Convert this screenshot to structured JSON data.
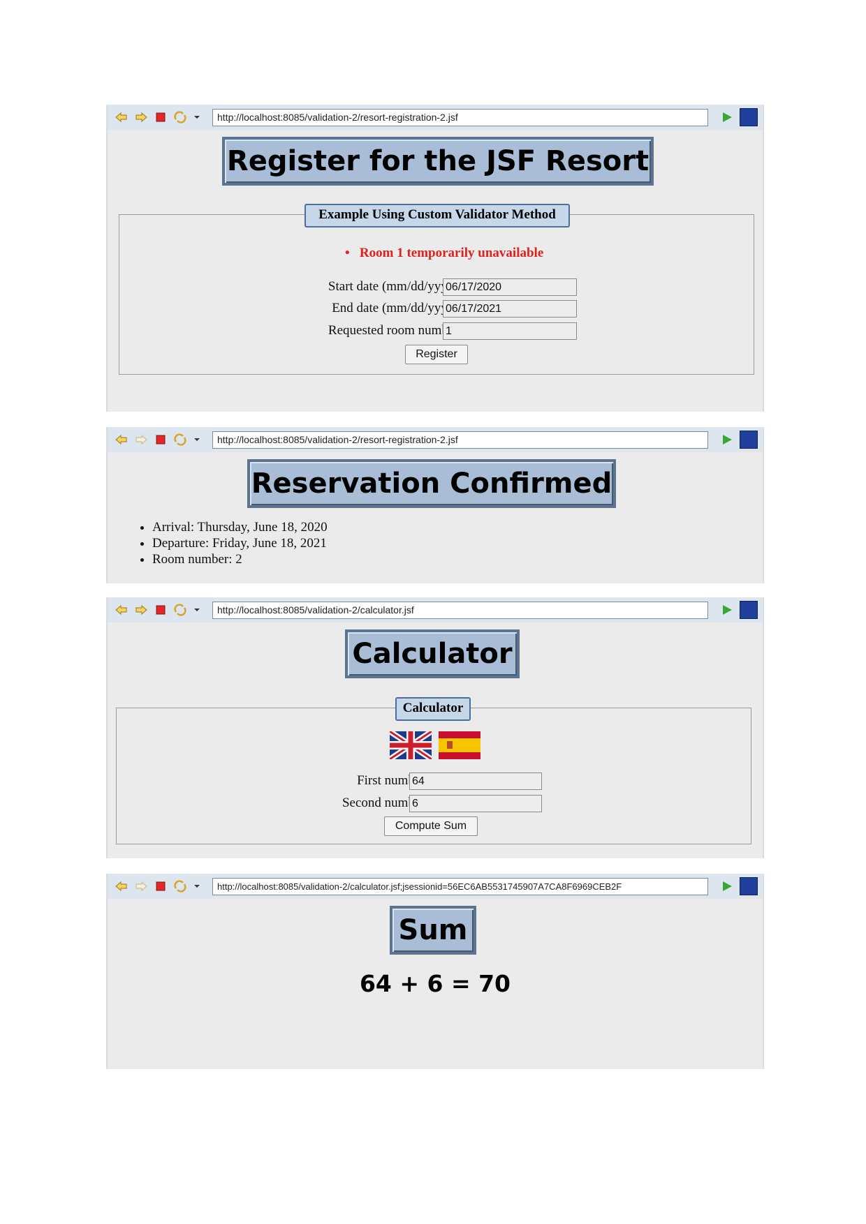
{
  "screens": [
    {
      "url": "http://localhost:8085/validation-2/resort-registration-2.jsf",
      "title": "Register for the JSF Resort",
      "legend": "Example Using Custom Validator Method",
      "error": "Room 1 temporarily unavailable",
      "fields": [
        {
          "label": "Start date (mm/dd/yyyy):",
          "value": "06/17/2020"
        },
        {
          "label": "End date (mm/dd/yyyy):",
          "value": "06/17/2021"
        },
        {
          "label": "Requested room number:",
          "value": "1"
        }
      ],
      "button": "Register"
    },
    {
      "url": "http://localhost:8085/validation-2/resort-registration-2.jsf",
      "title": "Reservation Confirmed",
      "items": [
        "Arrival: Thursday, June 18, 2020",
        "Departure: Friday, June 18, 2021",
        "Room number: 2"
      ]
    },
    {
      "url": "http://localhost:8085/validation-2/calculator.jsf",
      "title": "Calculator",
      "legend": "Calculator",
      "flags": [
        "uk-flag-icon",
        "spain-flag-icon"
      ],
      "fields": [
        {
          "label": "First number:",
          "value": "64"
        },
        {
          "label": "Second number:",
          "value": "6"
        }
      ],
      "button": "Compute Sum"
    },
    {
      "url": "http://localhost:8085/validation-2/calculator.jsf;jsessionid=56EC6AB5531745907A7CA8F6969CEB2F",
      "title": "Sum",
      "result": "64 + 6 = 70"
    }
  ],
  "colors": {
    "title_bg": "#a9bed6",
    "title_border": "#5b7590",
    "error": "#e0201c",
    "panel_bg": "#ebebeb",
    "toolbar_bg": "#dde6ef"
  }
}
